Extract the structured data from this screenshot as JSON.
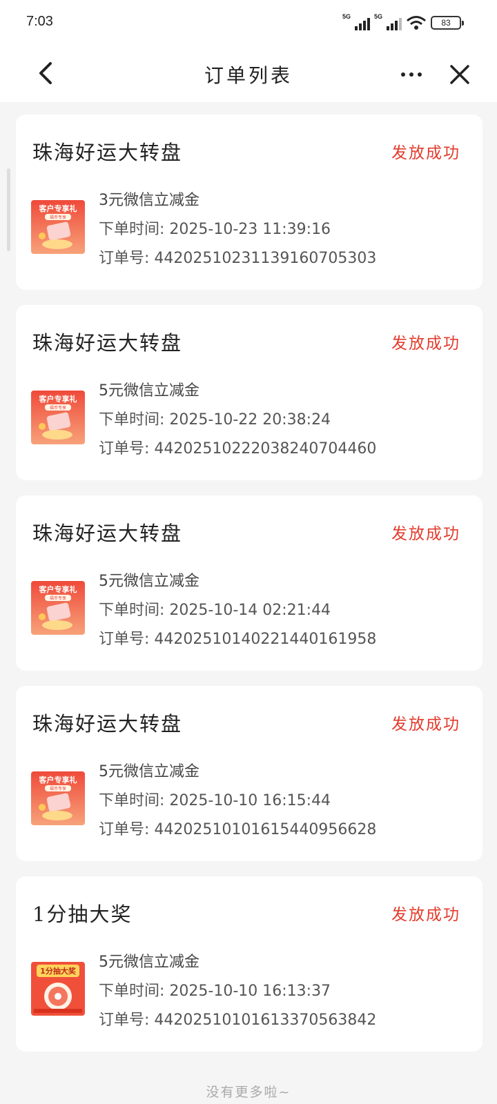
{
  "status_bar": {
    "time": "7:03",
    "signal1_tag": "5G",
    "signal2_tag": "5G",
    "battery": "83"
  },
  "nav": {
    "title": "订单列表"
  },
  "orders": [
    {
      "title": "珠海好运大转盘",
      "status": "发放成功",
      "product": "3元微信立减金",
      "order_time": "下单时间: 2025-10-23  11:39:16",
      "order_no": "订单号: 4420251023113916070530​3",
      "thumb_text": "客户专享礼",
      "thumb_sub": "福币专享",
      "thumb_icon": "gift-thumbnail-icon"
    },
    {
      "title": "珠海好运大转盘",
      "status": "发放成功",
      "product": "5元微信立减金",
      "order_time": "下单时间: 2025-10-22  20:38:24",
      "order_no": "订单号: 44202510222038240704460",
      "thumb_text": "客户专享礼",
      "thumb_sub": "福币专享",
      "thumb_icon": "gift-thumbnail-icon"
    },
    {
      "title": "珠海好运大转盘",
      "status": "发放成功",
      "product": "5元微信立减金",
      "order_time": "下单时间: 2025-10-14  02:21:44",
      "order_no": "订单号: 44202510140221440161958",
      "thumb_text": "客户专享礼",
      "thumb_sub": "福币专享",
      "thumb_icon": "gift-thumbnail-icon"
    },
    {
      "title": "珠海好运大转盘",
      "status": "发放成功",
      "product": "5元微信立减金",
      "order_time": "下单时间: 2025-10-10  16:15:44",
      "order_no": "订单号: 44202510101615440956628",
      "thumb_text": "客户专享礼",
      "thumb_sub": "福币专享",
      "thumb_icon": "gift-thumbnail-icon"
    },
    {
      "title": "1分抽大奖",
      "status": "发放成功",
      "product": "5元微信立减金",
      "order_time": "下单时间: 2025-10-10  16:13:37",
      "order_no": "订单号: 44202510101613370563842",
      "thumb_text": "1分抽大奖",
      "thumb_sub": "",
      "thumb_icon": "lottery-thumbnail-icon"
    }
  ],
  "footer": {
    "note": "没有更多啦~"
  },
  "colors": {
    "status_red": "#e23b2c",
    "thumb_red": "#f0503a"
  }
}
